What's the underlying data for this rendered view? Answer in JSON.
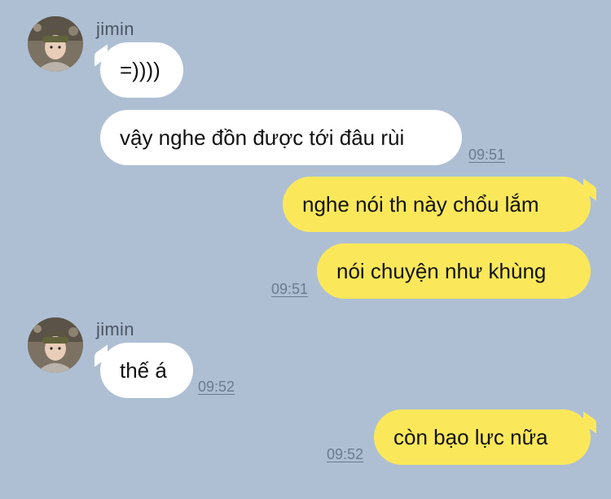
{
  "chat": {
    "messages": [
      {
        "sender": "jimin",
        "text": "=))))",
        "direction": "incoming"
      },
      {
        "text": "vậy nghe đồn được tới đâu rùi",
        "time": "09:51",
        "direction": "incoming"
      },
      {
        "text": "nghe nói th này chổu lắm",
        "direction": "outgoing"
      },
      {
        "text": "nói chuyện như khùng",
        "time": "09:51",
        "direction": "outgoing"
      },
      {
        "sender": "jimin",
        "text": "thế á",
        "time": "09:52",
        "direction": "incoming"
      },
      {
        "text": "còn bạo lực nữa",
        "time": "09:52",
        "direction": "outgoing"
      }
    ]
  },
  "colors": {
    "background": "#aebfd3",
    "incoming_bubble": "#ffffff",
    "outgoing_bubble": "#fbe85a",
    "timestamp": "#6b7a8e"
  },
  "icons": {
    "avatar": "profile-photo-avatar"
  }
}
